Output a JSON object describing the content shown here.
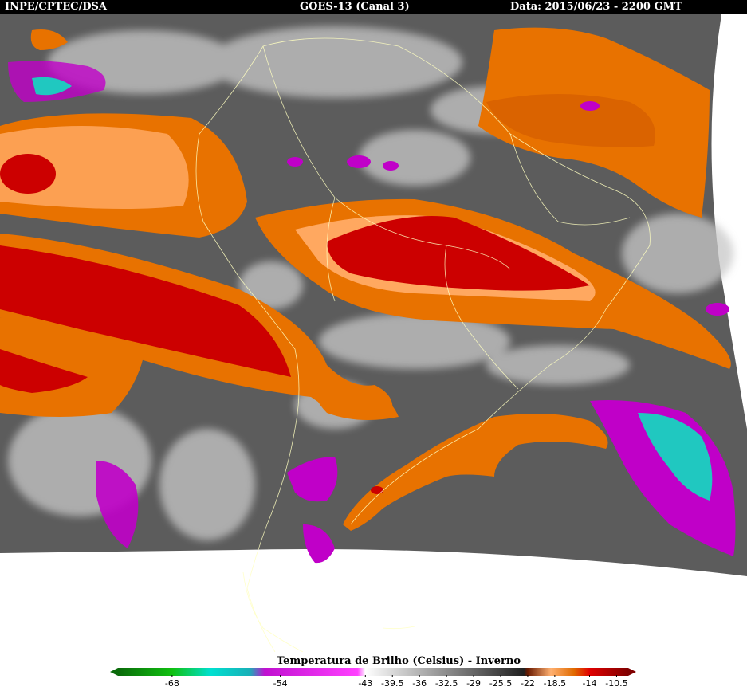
{
  "header": {
    "source": "INPE/CPTEC/DSA",
    "satellite": "GOES-13 (Canal 3)",
    "date": "Data: 2015/06/23 - 2200 GMT"
  },
  "legend": {
    "title": "Temperatura de Brilho (Celsius) - Inverno",
    "range": [
      -75,
      -9
    ],
    "ticks": [
      "-68",
      "-54",
      "-43",
      "-39.5",
      "-36",
      "-32.5",
      "-29",
      "-25.5",
      "-22",
      "-18.5",
      "-14",
      "-10.5"
    ],
    "tick_values": [
      -68,
      -54,
      -43,
      -39.5,
      -36,
      -32.5,
      -29,
      -25.5,
      -22,
      -18.5,
      -14,
      -10.5
    ],
    "color_stops": [
      {
        "t": -75,
        "c": "#0a6a0a"
      },
      {
        "t": -68,
        "c": "#10c010"
      },
      {
        "t": -63,
        "c": "#00e0d0"
      },
      {
        "t": -58,
        "c": "#18b0b8"
      },
      {
        "t": -56,
        "c": "#c010d0"
      },
      {
        "t": -44,
        "c": "#ff40ff"
      },
      {
        "t": -43,
        "c": "#ffffff"
      },
      {
        "t": -22.5,
        "c": "#202020"
      },
      {
        "t": -22,
        "c": "#6a1a00"
      },
      {
        "t": -19,
        "c": "#ffb070"
      },
      {
        "t": -16,
        "c": "#e06a00"
      },
      {
        "t": -14,
        "c": "#e00000"
      },
      {
        "t": -9,
        "c": "#800000"
      }
    ]
  },
  "colors": {
    "background_gray": "#5a5a5a",
    "cloud_white": "#d8d8d8",
    "orange": "#e87200",
    "light_orange": "#ffa860",
    "red": "#cc0000",
    "dark_red": "#7a1000",
    "magenta": "#c000c8",
    "cyan": "#20c8c0",
    "coastline": "#ffffc0"
  }
}
